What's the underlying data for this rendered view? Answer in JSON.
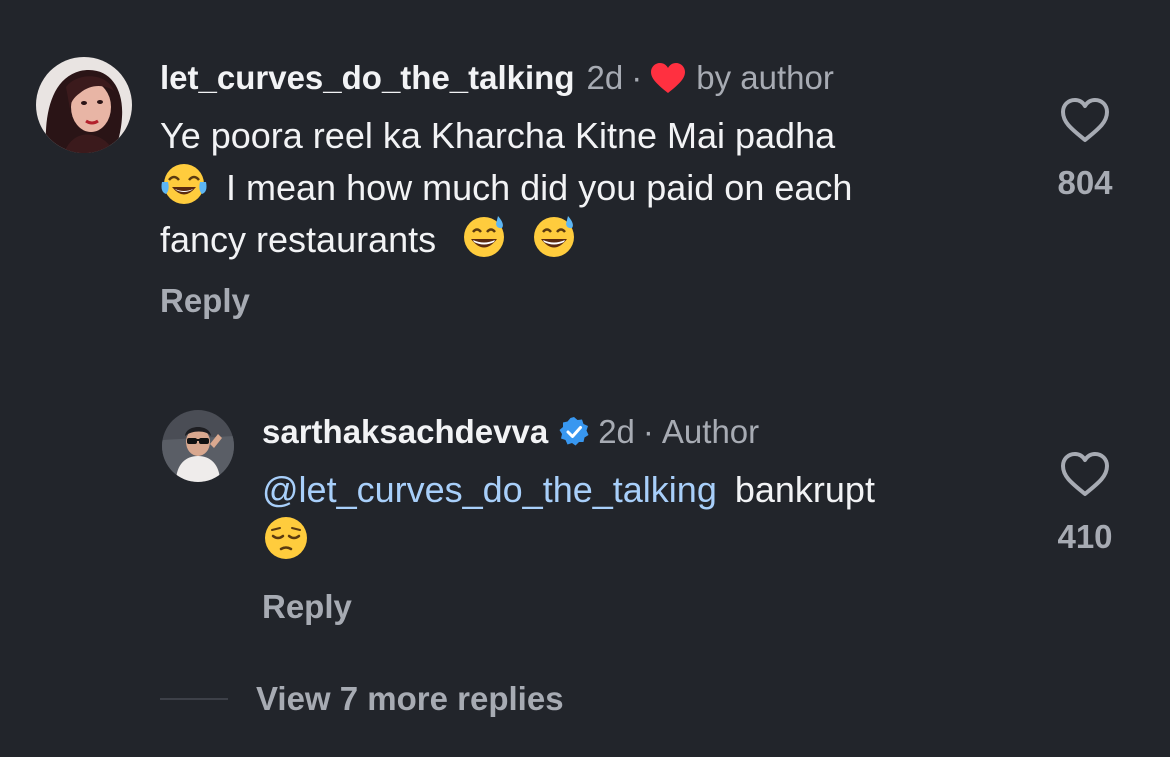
{
  "comment": {
    "username": "let_curves_do_the_talking",
    "age": "2d",
    "separator": "·",
    "liked_by": "by author",
    "text_line1": "Ye poora reel ka Kharcha Kitne Mai padha",
    "text_line2": "I mean how much did you paid on each",
    "text_line3": "fancy restaurants",
    "like_count": "804",
    "reply_label": "Reply",
    "emojis": [
      "face-with-tears-of-joy",
      "grinning-face-with-sweat",
      "grinning-face-with-sweat"
    ]
  },
  "reply": {
    "username": "sarthaksachdevva",
    "verified": true,
    "age": "2d",
    "separator": "·",
    "role": "Author",
    "mention": "@let_curves_do_the_talking",
    "text": "bankrupt",
    "like_count": "410",
    "reply_label": "Reply",
    "emojis": [
      "pensive-face"
    ]
  },
  "view_more": "View 7 more replies",
  "colors": {
    "background": "#22252b",
    "text": "#f2f3f5",
    "muted": "#a7abb3",
    "mention": "#a8cffa",
    "heart_red": "#ff3040",
    "verified_blue": "#3897f0"
  }
}
